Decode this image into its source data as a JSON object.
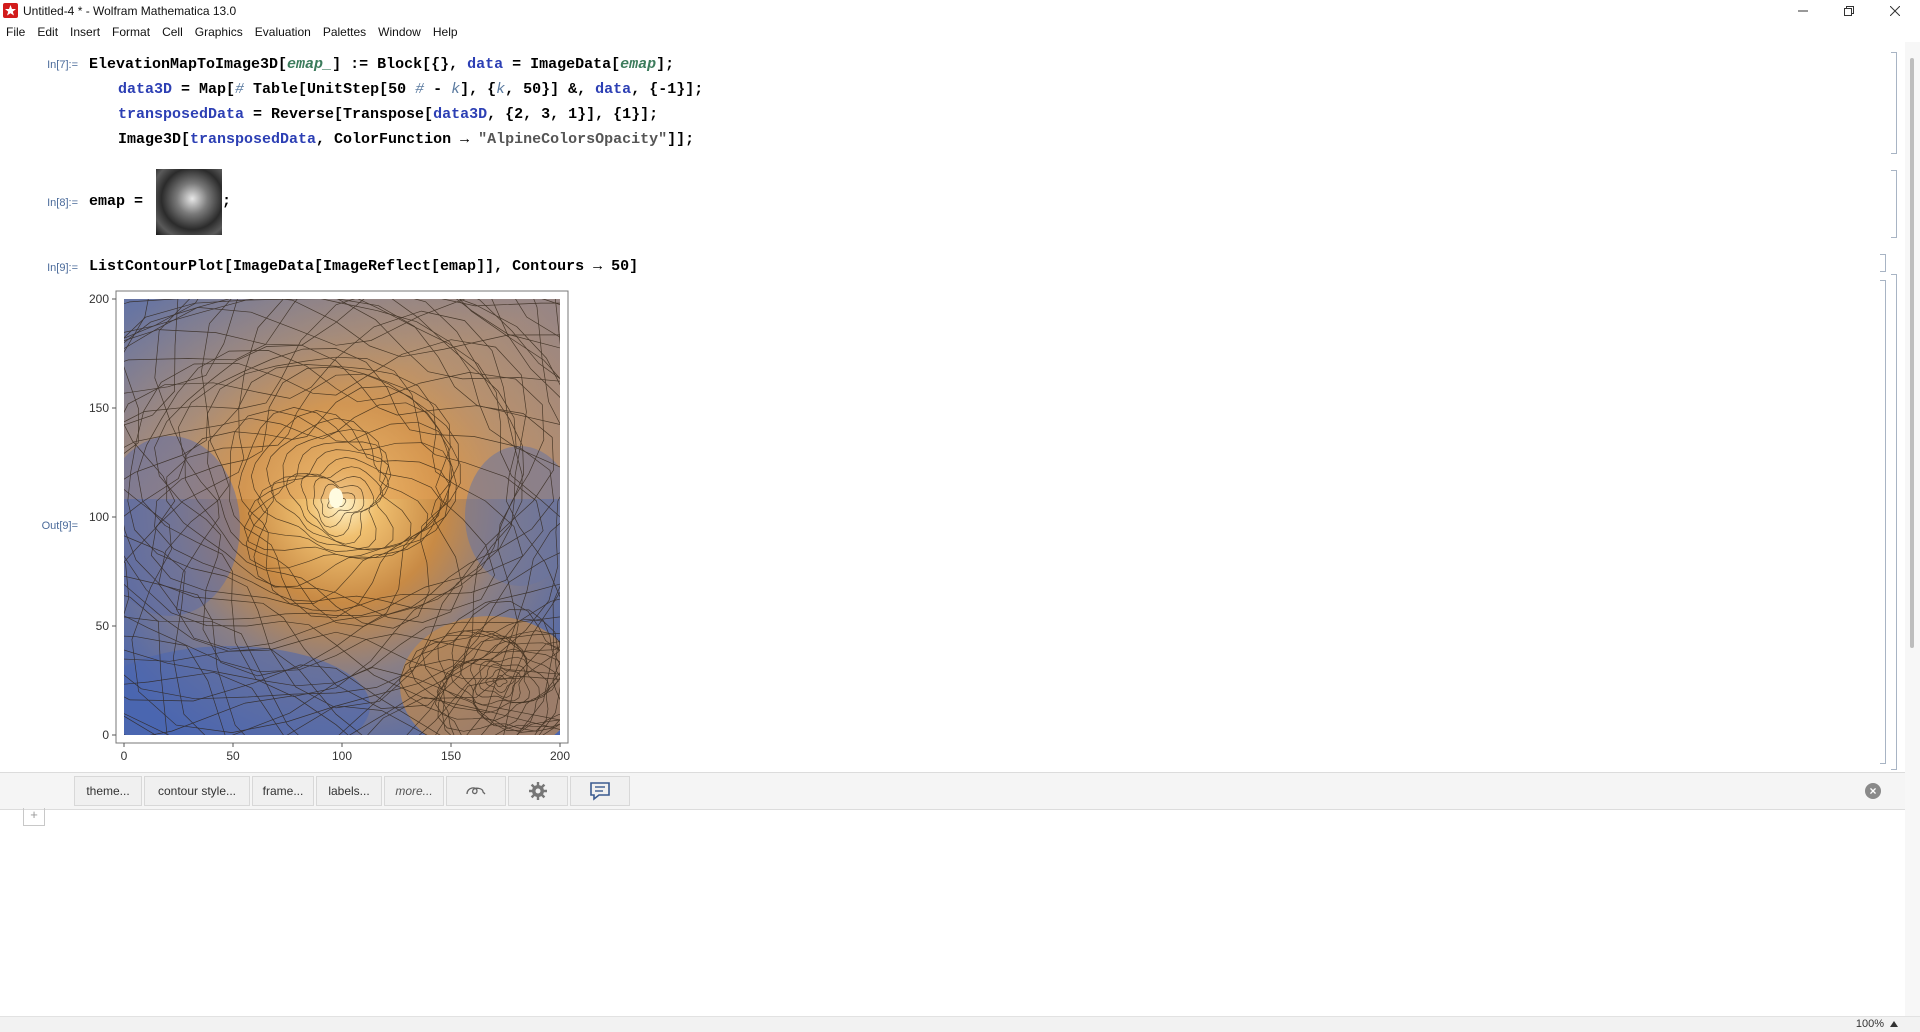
{
  "window": {
    "title": "Untitled-4 * - Wolfram Mathematica 13.0"
  },
  "menu": [
    "File",
    "Edit",
    "Insert",
    "Format",
    "Cell",
    "Graphics",
    "Evaluation",
    "Palettes",
    "Window",
    "Help"
  ],
  "cells": {
    "in7": {
      "label": "In[7]:=",
      "line1": {
        "fn": "ElevationMapToImage3D[",
        "arg": "emap_",
        "rest1": "] := Block[{}, ",
        "var": "data",
        "rest2": " = ImageData[",
        "arg2": "emap",
        "rest3": "];"
      },
      "line2": {
        "var": "data3D",
        "a": " = Map[",
        "slot": "#",
        "b": " Table[UnitStep[50 ",
        "slot2": "#",
        "c": " - ",
        "k": "k",
        "d": "], {",
        "k2": "k",
        "e": ", 50}] &, ",
        "var2": "data",
        "f": ", {-1}];"
      },
      "line3": {
        "var": "transposedData",
        "a": " = Reverse[Transpose[",
        "var2": "data3D",
        "b": ", {2, 3, 1}], {1}];"
      },
      "line4": {
        "a": "Image3D[",
        "var": "transposedData",
        "b": ", ColorFunction → ",
        "str": "\"AlpineColorsOpacity\"",
        "c": "]];"
      }
    },
    "in8": {
      "label": "In[8]:=",
      "code": "emap = ",
      "tail": ";"
    },
    "in9": {
      "label": "In[9]:=",
      "code": "ListContourPlot[ImageData[ImageReflect[emap]], Contours → 50]"
    },
    "out9": {
      "label": "Out[9]="
    }
  },
  "chart_data": {
    "type": "contour",
    "xticks": [
      0,
      50,
      100,
      150,
      200
    ],
    "yticks": [
      0,
      50,
      100,
      150,
      200
    ],
    "xlim": [
      0,
      200
    ],
    "ylim": [
      0,
      200
    ],
    "contours": 50,
    "colors": {
      "low": "#4a66b0",
      "mid": "#8a7f85",
      "high": "#e8a050",
      "peak": "#fff3c8"
    }
  },
  "suggestions": {
    "buttons": [
      "theme...",
      "contour style...",
      "frame...",
      "labels...",
      "more..."
    ],
    "icons": [
      "iconize-icon",
      "settings-gear-icon",
      "chat-icon"
    ]
  },
  "status": {
    "zoom": "100%"
  }
}
